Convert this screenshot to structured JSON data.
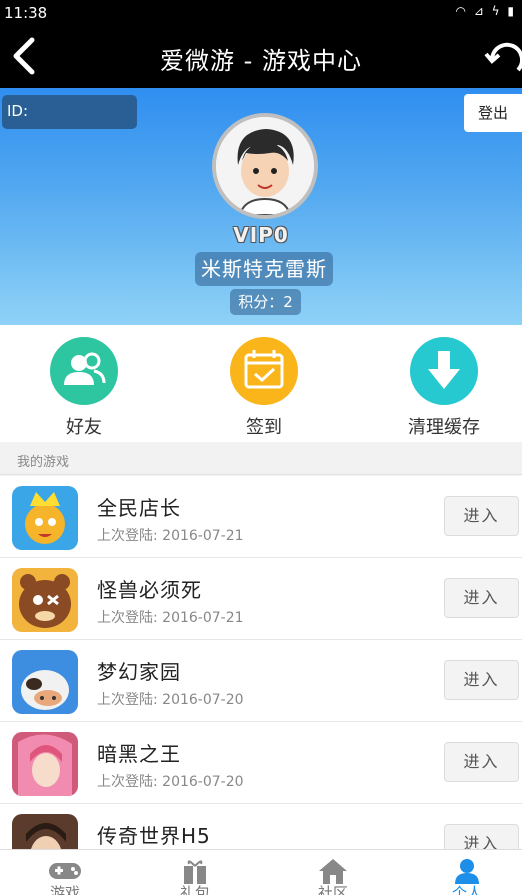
{
  "status_bar": {
    "time": "11:38",
    "icons": [
      "wifi-icon",
      "no-signal-icon",
      "charging-icon",
      "battery-icon"
    ]
  },
  "header": {
    "title": "爱微游 - 游戏中心",
    "back_icon": "back-arrow-icon",
    "refresh_icon": "refresh-icon"
  },
  "profile": {
    "id_label": "ID:",
    "logout_label": "登出",
    "vip_label": "VIP0",
    "username": "米斯特克雷斯",
    "points_label": "积分：2"
  },
  "actions": [
    {
      "label": "好友",
      "icon": "friends-icon",
      "color": "#2ec5a1"
    },
    {
      "label": "签到",
      "icon": "calendar-check-icon",
      "color": "#f9b51a"
    },
    {
      "label": "清理缓存",
      "icon": "download-arrow-icon",
      "color": "#26c9cf"
    }
  ],
  "my_games": {
    "heading": "我的游戏",
    "enter_label": "进入",
    "items": [
      {
        "name": "全民店长",
        "last_login": "上次登陆: 2016-07-21"
      },
      {
        "name": "怪兽必须死",
        "last_login": "上次登陆: 2016-07-21"
      },
      {
        "name": "梦幻家园",
        "last_login": "上次登陆: 2016-07-20"
      },
      {
        "name": "暗黑之王",
        "last_login": "上次登陆: 2016-07-20"
      },
      {
        "name": "传奇世界H5",
        "last_login": ""
      }
    ]
  },
  "tab_bar": {
    "active": "个人",
    "accent": "#1d8fe8",
    "tabs": [
      {
        "label": "游戏",
        "icon": "gamepad-icon"
      },
      {
        "label": "礼包",
        "icon": "gift-icon"
      },
      {
        "label": "社区",
        "icon": "home-icon"
      },
      {
        "label": "个人",
        "icon": "person-icon"
      }
    ]
  }
}
